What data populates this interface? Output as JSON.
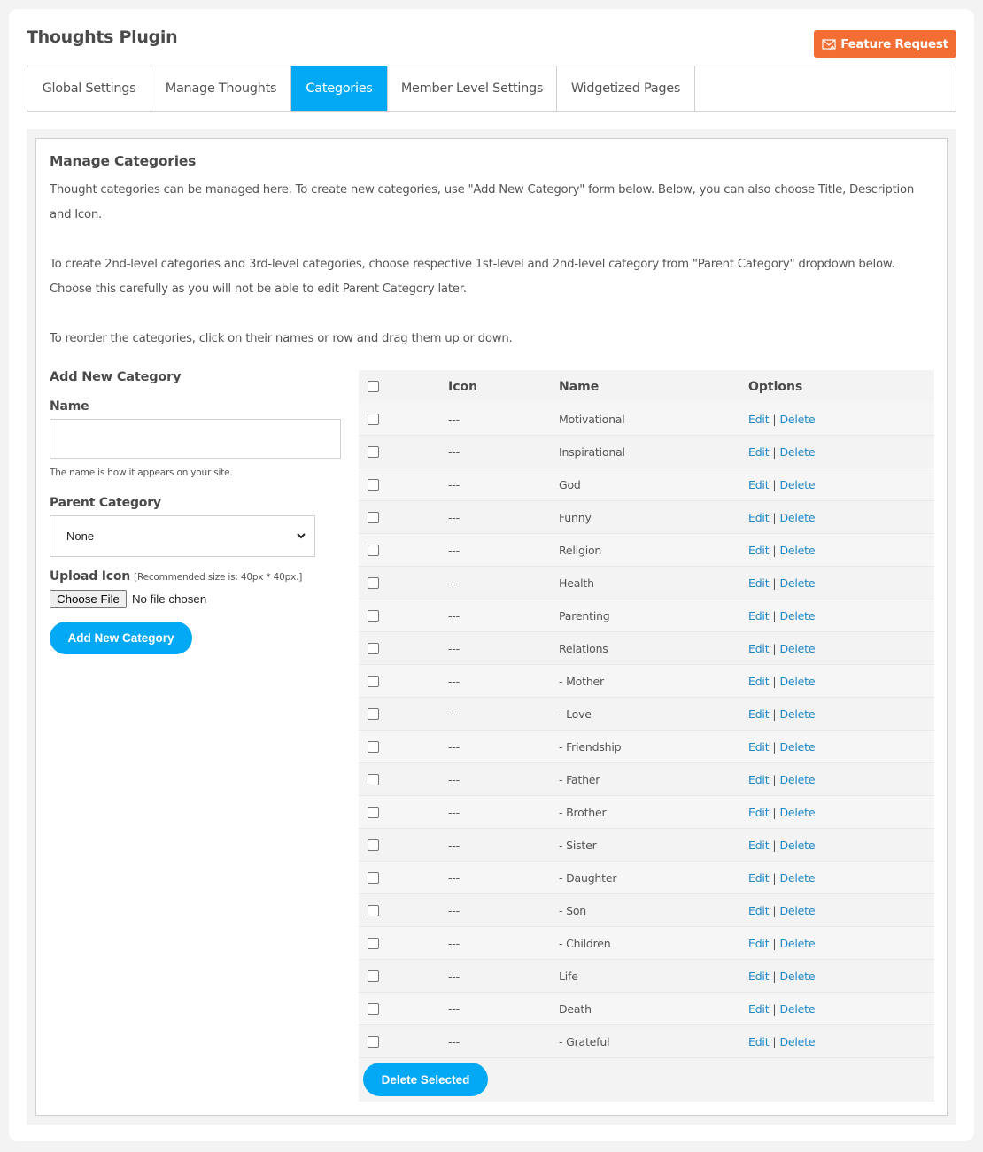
{
  "header": {
    "title": "Thoughts Plugin",
    "feature_request_label": "Feature Request",
    "feature_request_icon": "envelope-icon",
    "accent_color": "#03a9f4",
    "feature_color": "#f26e33"
  },
  "tabs": [
    {
      "label": "Global Settings",
      "active": false
    },
    {
      "label": "Manage Thoughts",
      "active": false
    },
    {
      "label": "Categories",
      "active": true
    },
    {
      "label": "Member Level Settings",
      "active": false
    },
    {
      "label": "Widgetized Pages",
      "active": false
    }
  ],
  "main": {
    "title": "Manage Categories",
    "paragraphs": [
      "Thought categories can be managed here. To create new categories, use \"Add New Category\" form below. Below, you can also choose Title, Description and Icon.",
      "To create 2nd-level categories and 3rd-level categories, choose respective 1st-level and 2nd-level category from \"Parent Category\" dropdown below. Choose this carefully as you will not be able to edit Parent Category later.",
      "To reorder the categories, click on their names or row and drag them up or down."
    ]
  },
  "form": {
    "title": "Add New Category",
    "name_label": "Name",
    "name_value": "",
    "name_hint": "The name is how it appears on your site.",
    "parent_label": "Parent Category",
    "parent_selected": "None",
    "upload_label": "Upload Icon",
    "upload_recommend": "[Recommended size is: 40px * 40px.]",
    "choose_file_label": "Choose File",
    "file_status": "No file chosen",
    "submit_label": "Add New Category"
  },
  "table": {
    "headers": {
      "icon": "Icon",
      "name": "Name",
      "options": "Options"
    },
    "edit_label": "Edit",
    "delete_label": "Delete",
    "separator": "|",
    "rows": [
      {
        "icon": "---",
        "name": "Motivational"
      },
      {
        "icon": "---",
        "name": "Inspirational"
      },
      {
        "icon": "---",
        "name": "God"
      },
      {
        "icon": "---",
        "name": "Funny"
      },
      {
        "icon": "---",
        "name": "Religion"
      },
      {
        "icon": "---",
        "name": "Health"
      },
      {
        "icon": "---",
        "name": "Parenting"
      },
      {
        "icon": "---",
        "name": "Relations"
      },
      {
        "icon": "---",
        "name": "- Mother"
      },
      {
        "icon": "---",
        "name": "- Love"
      },
      {
        "icon": "---",
        "name": "- Friendship"
      },
      {
        "icon": "---",
        "name": "- Father"
      },
      {
        "icon": "---",
        "name": "- Brother"
      },
      {
        "icon": "---",
        "name": "- Sister"
      },
      {
        "icon": "---",
        "name": "- Daughter"
      },
      {
        "icon": "---",
        "name": "- Son"
      },
      {
        "icon": "---",
        "name": "- Children"
      },
      {
        "icon": "---",
        "name": "Life"
      },
      {
        "icon": "---",
        "name": "Death"
      },
      {
        "icon": "---",
        "name": "- Grateful"
      }
    ],
    "delete_selected_label": "Delete Selected"
  }
}
